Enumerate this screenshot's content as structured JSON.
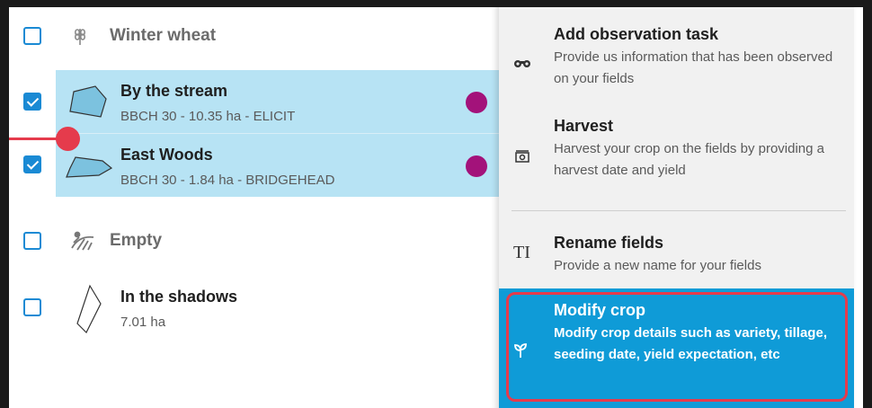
{
  "groups": [
    {
      "label": "Winter wheat",
      "icon": "wheat-icon",
      "checked": false
    },
    {
      "label": "Empty",
      "icon": "empty-field-icon",
      "checked": false
    }
  ],
  "fields": [
    {
      "name": "By the stream",
      "sub": "BBCH 30 - 10.35 ha - ELICIT",
      "checked": true
    },
    {
      "name": "East Woods",
      "sub": "BBCH 30 - 1.84 ha - BRIDGEHEAD",
      "checked": true
    },
    {
      "name": "In the shadows",
      "sub": "7.01 ha",
      "checked": false
    }
  ],
  "menu": [
    {
      "title": "Add observation task",
      "desc": "Provide us information that has been observed on your fields",
      "icon": "binoculars-icon"
    },
    {
      "title": "Harvest",
      "desc": "Harvest your crop on the fields by providing a harvest date and yield",
      "icon": "harvest-icon"
    },
    {
      "title": "Rename fields",
      "desc": "Provide a new name for your fields",
      "icon": "text-cursor-icon",
      "glyph": "TI"
    },
    {
      "title": "Modify crop",
      "desc": "Modify crop details such as variety, tillage, seeding date, yield expectation, etc",
      "icon": "sprout-icon"
    }
  ],
  "colors": {
    "accent": "#1a8ad4",
    "selection": "#b7e3f4",
    "dot": "#a3127a",
    "highlight": "#0f9bd7",
    "annotation": "#e53b4c"
  }
}
